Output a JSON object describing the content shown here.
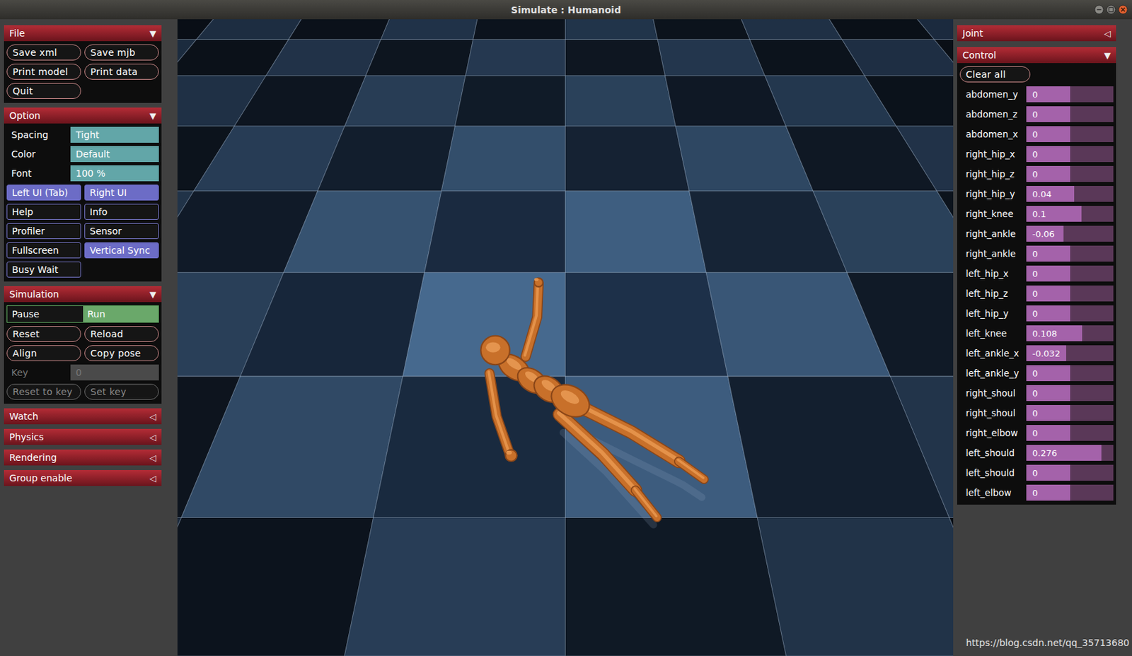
{
  "window": {
    "title": "Simulate : Humanoid"
  },
  "file": {
    "title": "File",
    "arrow": "▼",
    "expanded": true,
    "buttons": [
      "Save xml",
      "Save mjb",
      "Print model",
      "Print data",
      "Quit"
    ]
  },
  "option": {
    "title": "Option",
    "arrow": "▼",
    "expanded": true,
    "selects": [
      {
        "label": "Spacing",
        "value": "Tight"
      },
      {
        "label": "Color",
        "value": "Default"
      },
      {
        "label": "Font",
        "value": "100 %"
      }
    ],
    "toggles": [
      {
        "label": "Left UI (Tab)",
        "on": true
      },
      {
        "label": "Right UI",
        "on": true
      },
      {
        "label": "Help",
        "on": false
      },
      {
        "label": "Info",
        "on": false
      },
      {
        "label": "Profiler",
        "on": false
      },
      {
        "label": "Sensor",
        "on": false
      },
      {
        "label": "Fullscreen",
        "on": false
      },
      {
        "label": "Vertical Sync",
        "on": true
      },
      {
        "label": "Busy Wait",
        "on": false
      }
    ]
  },
  "simulation": {
    "title": "Simulation",
    "arrow": "▼",
    "expanded": true,
    "run_mode": [
      {
        "label": "Pause",
        "selected": false
      },
      {
        "label": "Run",
        "selected": true
      }
    ],
    "buttons": [
      "Reset",
      "Reload",
      "Align",
      "Copy pose"
    ],
    "key": {
      "label": "Key",
      "value": "0",
      "disabled": true
    },
    "key_buttons": [
      {
        "label": "Reset to key",
        "disabled": true
      },
      {
        "label": "Set key",
        "disabled": true
      }
    ]
  },
  "collapsed_sections": [
    {
      "title": "Watch",
      "arrow": "◁",
      "expanded": false
    },
    {
      "title": "Physics",
      "arrow": "◁",
      "expanded": false
    },
    {
      "title": "Rendering",
      "arrow": "◁",
      "expanded": false
    },
    {
      "title": "Group enable",
      "arrow": "◁",
      "expanded": false
    }
  ],
  "joint": {
    "title": "Joint",
    "arrow": "◁",
    "expanded": false
  },
  "control": {
    "title": "Control",
    "arrow": "▼",
    "expanded": true,
    "clear_button": "Clear all",
    "sliders": [
      {
        "name": "abdomen_y",
        "reading": "0",
        "level": 0.5
      },
      {
        "name": "abdomen_z",
        "reading": "0",
        "level": 0.5
      },
      {
        "name": "abdomen_x",
        "reading": "0",
        "level": 0.5
      },
      {
        "name": "right_hip_x",
        "reading": "0",
        "level": 0.5
      },
      {
        "name": "right_hip_z",
        "reading": "0",
        "level": 0.5
      },
      {
        "name": "right_hip_y",
        "reading": "0.04",
        "level": 0.55
      },
      {
        "name": "right_knee",
        "reading": "0.1",
        "level": 0.63
      },
      {
        "name": "right_ankle",
        "reading": "-0.06",
        "level": 0.43
      },
      {
        "name": "right_ankle",
        "reading": "0",
        "level": 0.5
      },
      {
        "name": "left_hip_x",
        "reading": "0",
        "level": 0.5
      },
      {
        "name": "left_hip_z",
        "reading": "0",
        "level": 0.5
      },
      {
        "name": "left_hip_y",
        "reading": "0",
        "level": 0.5
      },
      {
        "name": "left_knee",
        "reading": "0.108",
        "level": 0.64
      },
      {
        "name": "left_ankle_x",
        "reading": "-0.032",
        "level": 0.46
      },
      {
        "name": "left_ankle_y",
        "reading": "0",
        "level": 0.5
      },
      {
        "name": "right_shoul",
        "reading": "0",
        "level": 0.5
      },
      {
        "name": "right_shoul",
        "reading": "0",
        "level": 0.5
      },
      {
        "name": "right_elbow",
        "reading": "0",
        "level": 0.5
      },
      {
        "name": "left_should",
        "reading": "0.276",
        "level": 0.86
      },
      {
        "name": "left_should",
        "reading": "0",
        "level": 0.5
      },
      {
        "name": "left_elbow",
        "reading": "0",
        "level": 0.5
      }
    ]
  },
  "watermark": "https://blog.csdn.net/qq_35713680"
}
